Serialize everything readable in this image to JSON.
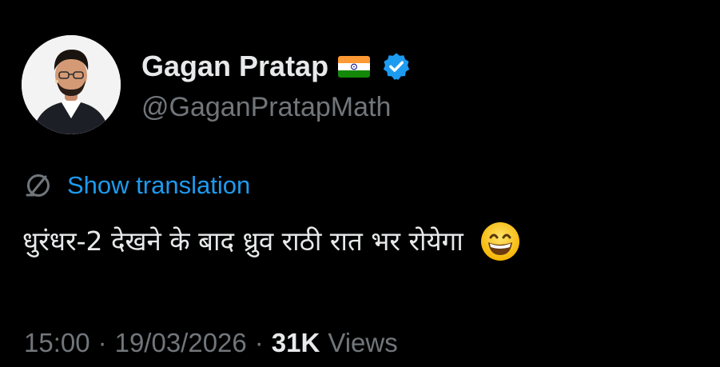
{
  "author": {
    "display_name": "Gagan Pratap",
    "handle": "@GaganPratapMath",
    "flag_icon": "india-flag-icon",
    "verified_icon": "verified-badge-icon",
    "verified_color": "#1d9bf0"
  },
  "translation": {
    "label": "Show translation",
    "icon": "translate-globe-icon",
    "color": "#1d9bf0"
  },
  "tweet": {
    "text": "धुरंधर-2 देखने के बाद ध्रुव राठी रात भर रोयेगा",
    "emoji_icon": "grinning-face-icon"
  },
  "meta": {
    "time": "15:00",
    "separator": "·",
    "date": "19/03/2026",
    "views_count": "31K",
    "views_label": "Views"
  },
  "colors": {
    "background": "#000000",
    "primary_text": "#e7e9ea",
    "secondary_text": "#71767b",
    "accent": "#1d9bf0"
  }
}
